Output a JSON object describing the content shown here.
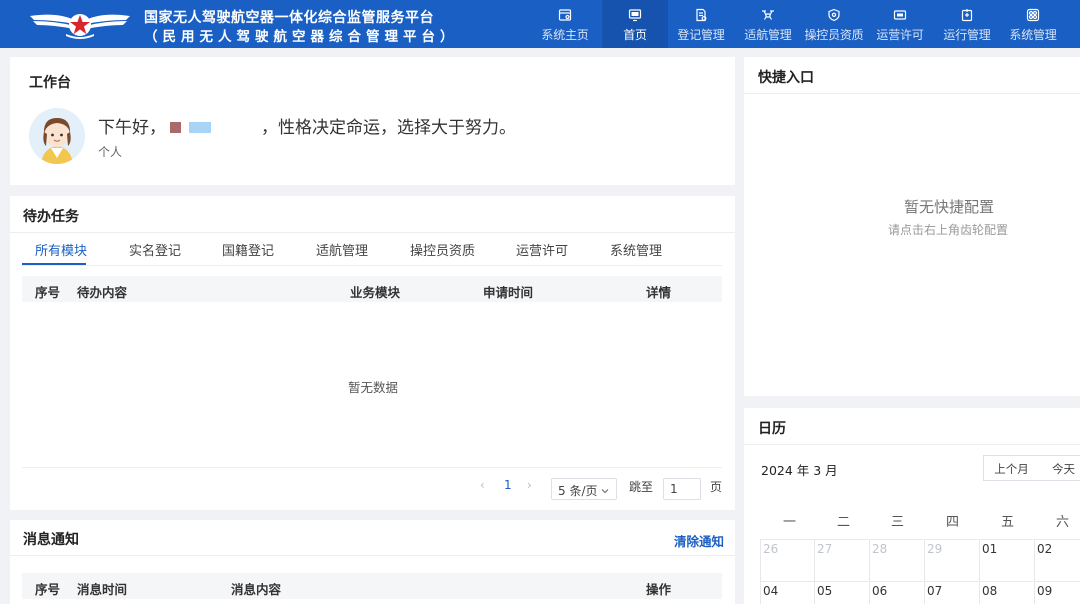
{
  "header": {
    "title_main": "国家无人驾驶航空器一体化综合监管服务平台",
    "title_sub": "（民用无人驾驶航空器综合管理平台）",
    "nav": [
      {
        "label": "系统主页",
        "icon": "browser-icon"
      },
      {
        "label": "首页",
        "icon": "monitor-icon"
      },
      {
        "label": "登记管理",
        "icon": "document-edit-icon"
      },
      {
        "label": "适航管理",
        "icon": "drone-icon"
      },
      {
        "label": "操控员资质",
        "icon": "shield-icon"
      },
      {
        "label": "运营许可",
        "icon": "id-card-icon"
      },
      {
        "label": "运行管理",
        "icon": "clipboard-icon"
      },
      {
        "label": "系统管理",
        "icon": "settings-grid-icon"
      }
    ],
    "active_nav": "首页",
    "colors": {
      "bar": "#1a5fc4",
      "active": "#1553ae"
    }
  },
  "workbench": {
    "title": "工作台",
    "greeting_prefix": "下午好，",
    "greeting_suffix": "，性格决定命运，选择大于努力。",
    "role": "个人"
  },
  "todo": {
    "title": "待办任务",
    "tabs": [
      "所有模块",
      "实名登记",
      "国籍登记",
      "适航管理",
      "操控员资质",
      "运营许可",
      "系统管理"
    ],
    "active_tab": "所有模块",
    "columns": [
      "序号",
      "待办内容",
      "业务模块",
      "申请时间",
      "详情"
    ],
    "empty_text": "暂无数据",
    "pagination": {
      "prev": "‹",
      "current_page": "1",
      "next": "›",
      "page_size": "5 条/页",
      "jump_label": "跳至",
      "jump_value": "1",
      "page_unit": "页"
    }
  },
  "notice": {
    "title": "消息通知",
    "clear_label": "清除通知",
    "columns": [
      "序号",
      "消息时间",
      "消息内容",
      "操作"
    ]
  },
  "shortcuts": {
    "title": "快捷入口",
    "empty_title": "暂无快捷配置",
    "empty_hint": "请点击右上角齿轮配置"
  },
  "calendar": {
    "title": "日历",
    "month_label": "2024 年 3 月",
    "prev_month": "上个月",
    "today": "今天",
    "weekdays": [
      "一",
      "二",
      "三",
      "四",
      "五",
      "六"
    ],
    "rows": [
      [
        {
          "d": "26",
          "other": true
        },
        {
          "d": "27",
          "other": true
        },
        {
          "d": "28",
          "other": true
        },
        {
          "d": "29",
          "other": true
        },
        {
          "d": "01"
        },
        {
          "d": "02"
        }
      ],
      [
        {
          "d": "04"
        },
        {
          "d": "05"
        },
        {
          "d": "06"
        },
        {
          "d": "07"
        },
        {
          "d": "08"
        },
        {
          "d": "09"
        }
      ]
    ]
  }
}
